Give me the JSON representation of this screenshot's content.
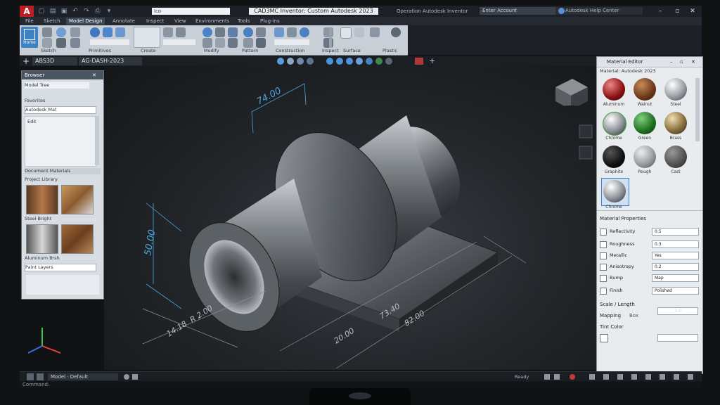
{
  "titlebar": {
    "logo": "A",
    "search": "Ico",
    "title": "CAD3MC Inventor: Custom Autodesk 2023",
    "subtitle": "Operation Autodesk Inventor",
    "user": "Enter Account",
    "help": "Autodesk Help Center"
  },
  "tabs": [
    "File",
    "Sketch",
    "Model Design",
    "Annotate",
    "Inspect",
    "View",
    "Environments",
    "Tools",
    "Plug-ins"
  ],
  "ribbon": {
    "home_label": "Home",
    "panels": [
      "Sketch",
      "Primitives",
      "Create",
      "Modify",
      "Pattern",
      "Construction",
      "Inspect",
      "Surface",
      "Plastic"
    ]
  },
  "filetabs": {
    "plus": "+",
    "tab1": "ABS3D",
    "tab2": "AG-DASH-2023"
  },
  "palette": {
    "header": "Browser",
    "row1": "Model Tree",
    "row2": "Favorites",
    "row3": "Autodesk Mat",
    "row4": "Edit",
    "section": "Document Materials",
    "section2": "Project Library",
    "mat1": "Steel Bright",
    "mat2": "Aluminum Brsh",
    "foot": "Paint Layers"
  },
  "matbrowser": {
    "title": "Material Editor",
    "subtitle": "Material: Autodesk 2023",
    "balls": [
      "Aluminum",
      "Walnut",
      "Steel",
      "Chrome",
      "Green",
      "Brass",
      "Graphite",
      "Rough",
      "Cast",
      "Chrome"
    ],
    "props_header": "Material Properties",
    "props": [
      {
        "label": "Reflectivity",
        "value": "0.5"
      },
      {
        "label": "Roughness",
        "value": "0.3"
      },
      {
        "label": "Metallic",
        "value": "Yes"
      },
      {
        "label": "Anisotropy",
        "value": "0.2"
      },
      {
        "label": "Bump",
        "value": "Map"
      },
      {
        "label": "Finish",
        "value": "Polished"
      }
    ],
    "scale_label": "Scale / Length",
    "scale_value": "1.0",
    "mapping_label": "Mapping",
    "mapping_value": "Box",
    "tint_label": "Tint Color"
  },
  "viewport": {
    "dims": [
      "74.00",
      "50.00",
      "82.00",
      "20.00",
      "14.18",
      "R 2.00",
      "20.00",
      "73.40"
    ],
    "viewcube": "FRONT"
  },
  "statusbar": {
    "model": "Model · Default",
    "coord": "Ready"
  },
  "bottomstrip": "Command:"
}
